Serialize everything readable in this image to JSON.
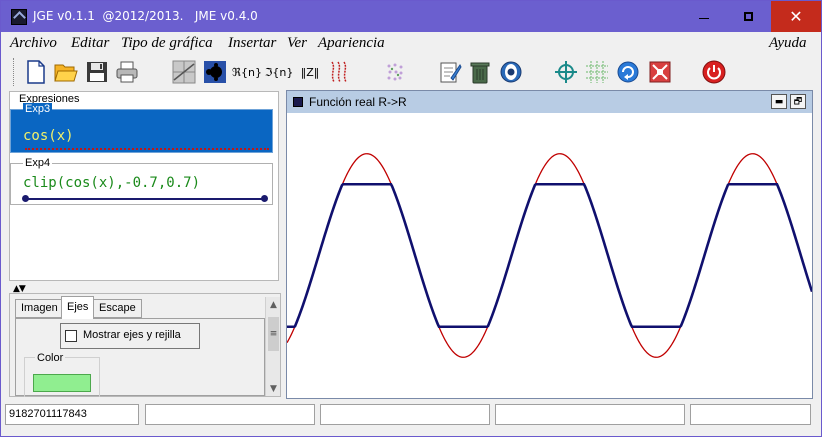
{
  "window": {
    "title": "JGE v0.1.1  @2012/2013.   JME v0.4.0",
    "minimize_glyph": "",
    "close_glyph": "✕"
  },
  "menu": {
    "items": [
      "Archivo",
      "Editar",
      "Tipo de gráfica",
      "Insertar",
      "Ver",
      "Apariencia"
    ],
    "help": "Ayuda"
  },
  "toolbar": {
    "icons": [
      "new-document-icon",
      "open-folder-icon",
      "save-disk-icon",
      "print-icon",
      "plot-grid-icon",
      "fractal-icon",
      "real-part-icon",
      "imaginary-part-icon",
      "norm-icon",
      "integer-icon",
      "parametric-icon",
      "dots-pattern-icon",
      "edit-notepad-icon",
      "trash-can-icon",
      "eye-icon",
      "crosshair-icon",
      "grid-icon",
      "refresh-icon",
      "zoom-fit-icon",
      "power-icon"
    ],
    "real_label": "ℜ{n}",
    "imag_label": "ℑ{n}",
    "norm_label": "‖Z‖"
  },
  "expressions": {
    "panel_title": "Expresiones",
    "items": [
      {
        "label": "Exp3",
        "text": "cos(x)"
      },
      {
        "label": "Exp4",
        "text": "clip(cos(x),-0.7,0.7)"
      }
    ]
  },
  "options": {
    "tabs": [
      "Imagen",
      "Ejes",
      "Escape"
    ],
    "active_tab": "Ejes",
    "axes_checkbox_label": "Mostrar ejes y rejilla",
    "axes_checked": false,
    "color_label": "Color",
    "color_value": "#90ee90"
  },
  "graph": {
    "title": "Función real R->R",
    "minimize_glyph": "▬",
    "restore_glyph": "🗗"
  },
  "status": {
    "cells": [
      "9182701117843",
      "",
      "",
      "",
      ""
    ]
  },
  "chart_data": {
    "type": "line",
    "xlim": [
      -2.6,
      14.5
    ],
    "ylim": [
      -1.4,
      1.4
    ],
    "grid": false,
    "series": [
      {
        "expr": "cos(x)",
        "color": "#c00000"
      },
      {
        "expr": "clip(cos(x),-0.7,0.7)",
        "color": "#10106e"
      }
    ]
  },
  "colors": {
    "titlebar": "#6b5fcf",
    "selection": "#0a66c2",
    "expr_text_selected": "#f1f16a",
    "expr_text": "#1a8a1a"
  }
}
